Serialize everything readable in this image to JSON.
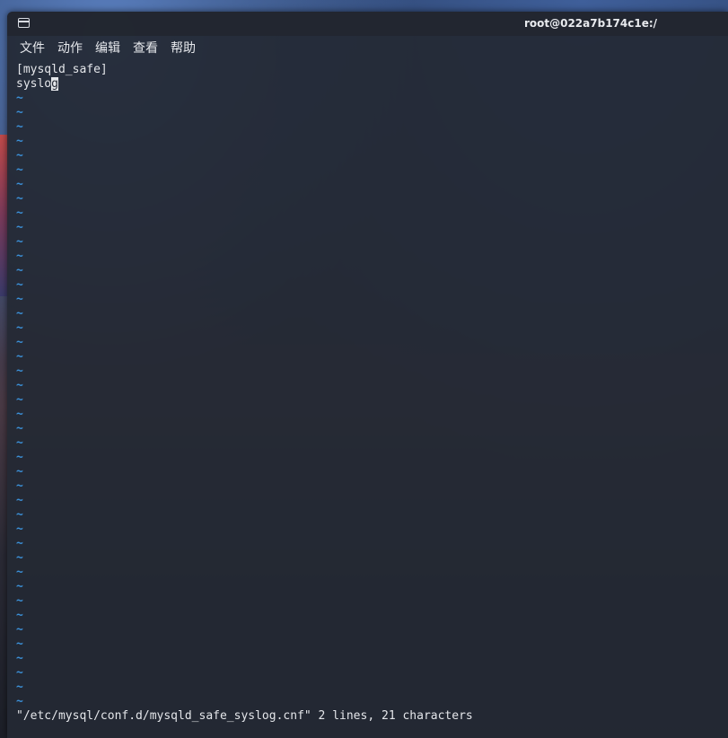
{
  "window": {
    "title": "root@022a7b174c1e:/"
  },
  "menu": {
    "items": [
      "文件",
      "动作",
      "编辑",
      "查看",
      "帮助"
    ]
  },
  "editor": {
    "lines": [
      "[mysqld_safe]",
      "syslo"
    ],
    "cursor_char": "g",
    "empty_line_marker": "~",
    "empty_line_count": 43
  },
  "status": {
    "message": "\"/etc/mysql/conf.d/mysqld_safe_syslog.cnf\" 2 lines, 21 characters"
  },
  "colors": {
    "tilde": "#3b8fd6",
    "text": "#e4e6ea",
    "terminal_bg": "#242934"
  }
}
